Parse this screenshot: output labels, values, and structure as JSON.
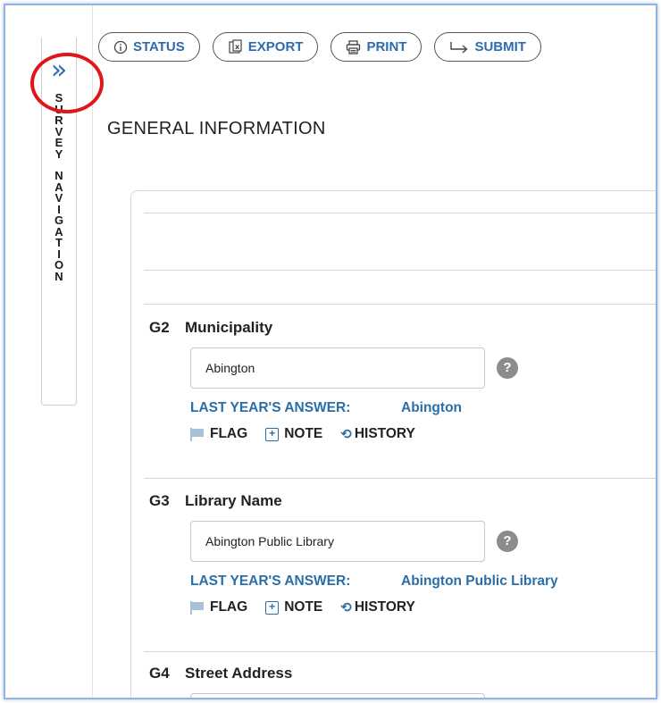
{
  "toolbar": {
    "status_label": "STATUS",
    "export_label": "EXPORT",
    "print_label": "PRINT",
    "submit_label": "SUBMIT"
  },
  "sidebar": {
    "toggle_glyph": "»",
    "title_words": [
      "SURVEY",
      "NAVIGATION"
    ]
  },
  "section": {
    "title": "GENERAL INFORMATION"
  },
  "labels": {
    "last_year": "LAST YEAR'S ANSWER:",
    "flag": "FLAG",
    "note": "NOTE",
    "history": "HISTORY",
    "help": "?"
  },
  "questions": [
    {
      "id": "G2",
      "label": "Municipality",
      "value": "Abington",
      "last_year_answer": "Abington"
    },
    {
      "id": "G3",
      "label": "Library Name",
      "value": "Abington Public Library",
      "last_year_answer": "Abington Public Library"
    },
    {
      "id": "G4",
      "label": "Street Address",
      "value": "",
      "last_year_answer": ""
    }
  ],
  "colors": {
    "accent": "#2b6ea6",
    "highlight_circle": "#e0161a",
    "frame_border": "#8fb4e0"
  }
}
